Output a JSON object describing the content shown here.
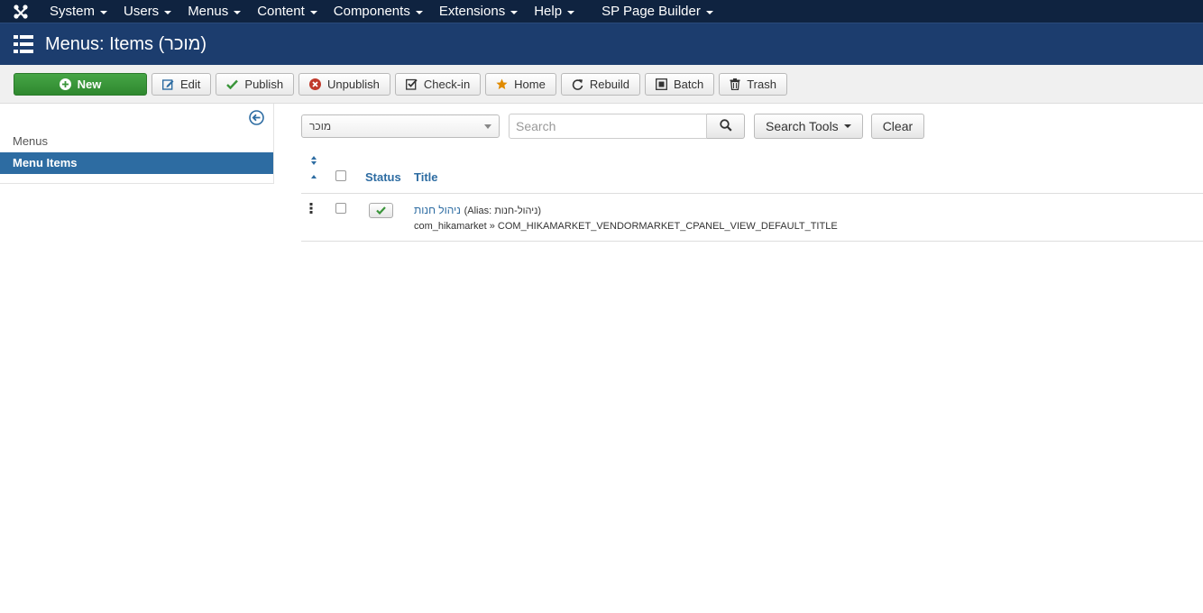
{
  "topnav": {
    "items": [
      {
        "label": "System"
      },
      {
        "label": "Users"
      },
      {
        "label": "Menus"
      },
      {
        "label": "Content"
      },
      {
        "label": "Components"
      },
      {
        "label": "Extensions"
      },
      {
        "label": "Help"
      },
      {
        "label": "SP Page Builder"
      }
    ]
  },
  "header": {
    "title": "Menus: Items (מוכר)"
  },
  "toolbar": {
    "new": "New",
    "edit": "Edit",
    "publish": "Publish",
    "unpublish": "Unpublish",
    "checkin": "Check-in",
    "home": "Home",
    "rebuild": "Rebuild",
    "batch": "Batch",
    "trash": "Trash"
  },
  "sidebar": {
    "items": [
      {
        "label": "Menus",
        "active": false
      },
      {
        "label": "Menu Items",
        "active": true
      }
    ]
  },
  "filters": {
    "menu_select_value": "מוכר",
    "search_placeholder": "Search",
    "search_value": "",
    "search_tools_label": "Search Tools",
    "clear_label": "Clear"
  },
  "table": {
    "headers": {
      "status": "Status",
      "title": "Title"
    },
    "rows": [
      {
        "title": "ניהול חנות",
        "alias": "(Alias: ניהול-חנות)",
        "link": "com_hikamarket » COM_HIKAMARKET_VENDORMARKET_CPANEL_VIEW_DEFAULT_TITLE",
        "published": true
      }
    ]
  },
  "colors": {
    "topnav_bg": "#0f2340",
    "header_bg": "#1c3d6e",
    "new_button": "#3f9b3f",
    "accent": "#2d6ca2"
  }
}
